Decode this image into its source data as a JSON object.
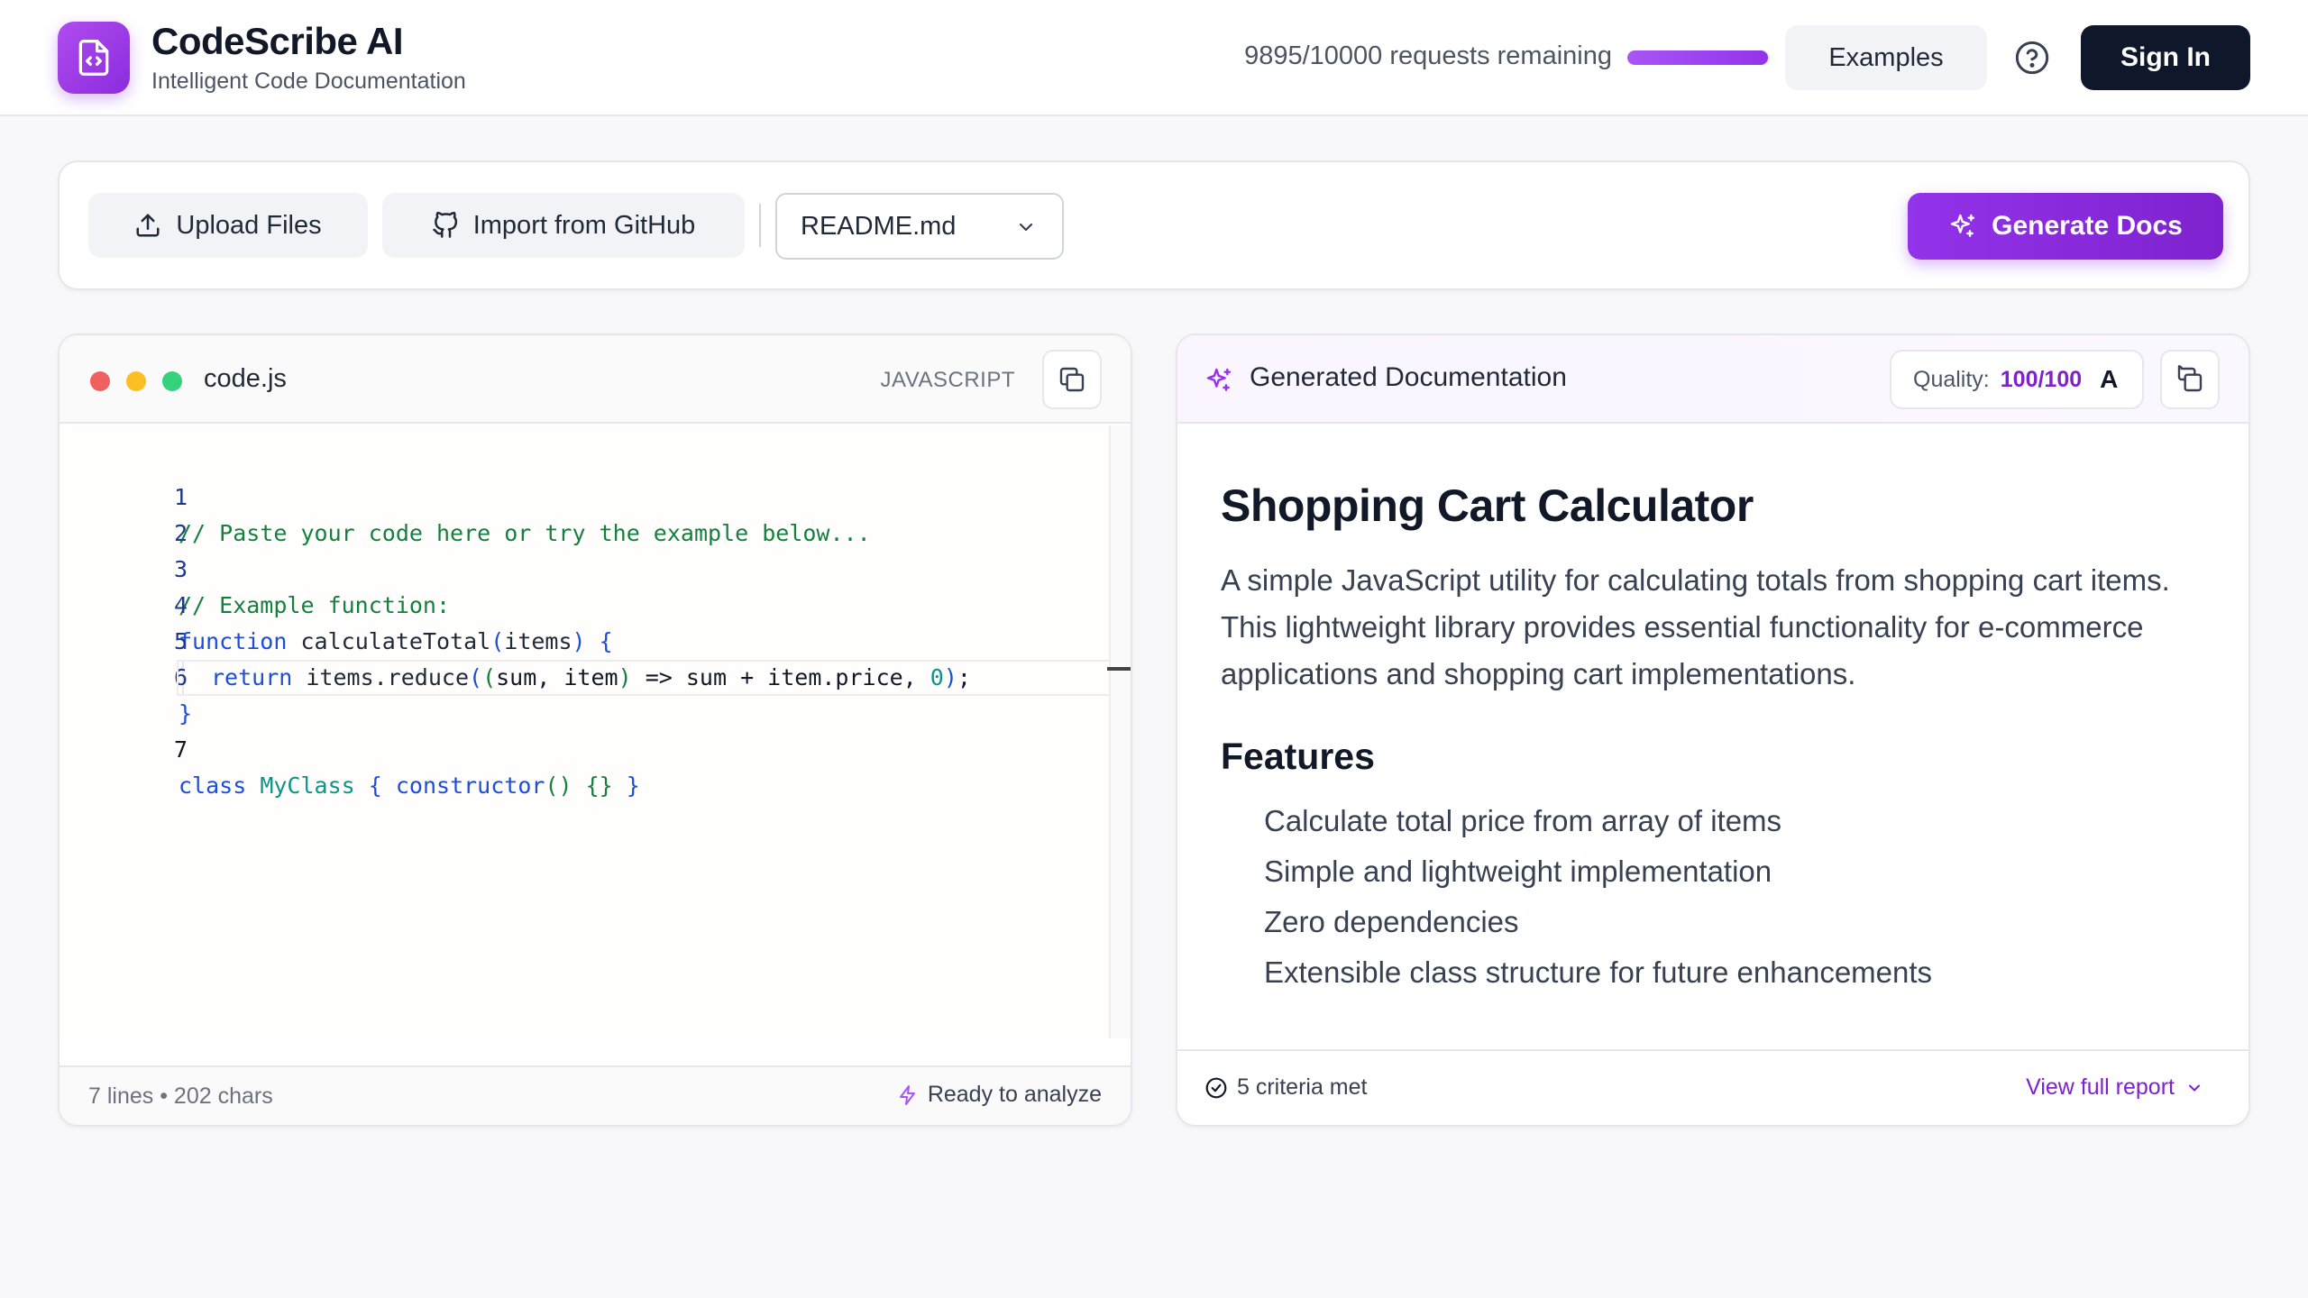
{
  "app": {
    "title": "CodeScribe AI",
    "subtitle": "Intelligent Code Documentation"
  },
  "header": {
    "requests_text": "9895/10000 requests remaining",
    "requests_used_fraction": 0.9895,
    "examples_label": "Examples",
    "help_icon": "question-circle-icon",
    "signin_label": "Sign In"
  },
  "toolbar": {
    "upload_label": "Upload Files",
    "github_label": "Import from GitHub",
    "selected_template": "README.md",
    "generate_label": "Generate Docs"
  },
  "editor": {
    "filename": "code.js",
    "language": "JAVASCRIPT",
    "line_numbers": [
      "1",
      "2",
      "3",
      "4",
      "5",
      "6",
      "7"
    ],
    "stats": "7 lines • 202 chars",
    "status": "Ready to analyze"
  },
  "doc": {
    "panel_title": "Generated Documentation",
    "quality_label": "Quality:",
    "quality_score": "100/100",
    "quality_grade": "A",
    "h1": "Shopping Cart Calculator",
    "paragraph": "A simple JavaScript utility for calculating totals from shopping cart items. This lightweight library provides essential functionality for e-commerce applications and shopping cart implementations.",
    "h2": "Features",
    "features": [
      "Calculate total price from array of items",
      "Simple and lightweight implementation",
      "Zero dependencies",
      "Extensible class structure for future enhancements"
    ],
    "criteria_text": "5 criteria met",
    "view_report_label": "View full report"
  },
  "colors": {
    "accent": "#9333ea",
    "dark": "#0f172a",
    "dot_red": "#f15f5f",
    "dot_yellow": "#fbbf24",
    "dot_green": "#34d27a"
  }
}
